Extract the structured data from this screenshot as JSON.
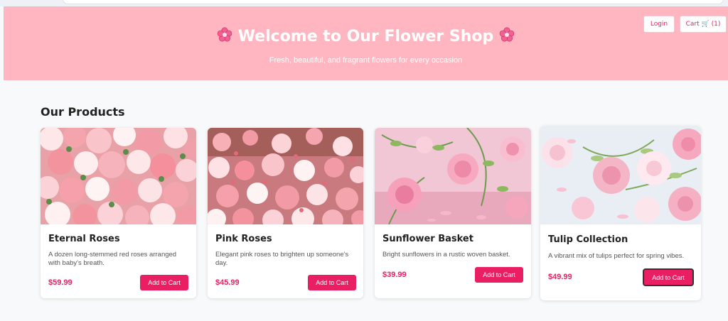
{
  "header": {
    "title": "Welcome to Our Flower Shop",
    "subtitle": "Fresh, beautiful, and fragrant flowers for every occasion",
    "login_label": "Login",
    "cart_label": "Cart 🛒 (1)"
  },
  "products_section": {
    "title": "Our Products",
    "items": [
      {
        "name": "Eternal Roses",
        "description": "A dozen long-stemmed red roses arranged with baby's breath.",
        "price": "$59.99",
        "button": "Add to Cart",
        "image": "rose-bouquet-image"
      },
      {
        "name": "Pink Roses",
        "description": "Elegant pink roses to brighten up someone's day.",
        "price": "$45.99",
        "button": "Add to Cart",
        "image": "pink-roses-image"
      },
      {
        "name": "Sunflower Basket",
        "description": "Bright sunflowers in a rustic woven basket.",
        "price": "$39.99",
        "button": "Add to Cart",
        "image": "sunflower-basket-image"
      },
      {
        "name": "Tulip Collection",
        "description": "A vibrant mix of tulips perfect for spring vibes.",
        "price": "$49.99",
        "button": "Add to Cart",
        "image": "tulip-collection-image"
      }
    ]
  },
  "colors": {
    "hero_background": "#ffb6c1",
    "accent": "#e91e63",
    "page_background": "#f8f9fa"
  }
}
